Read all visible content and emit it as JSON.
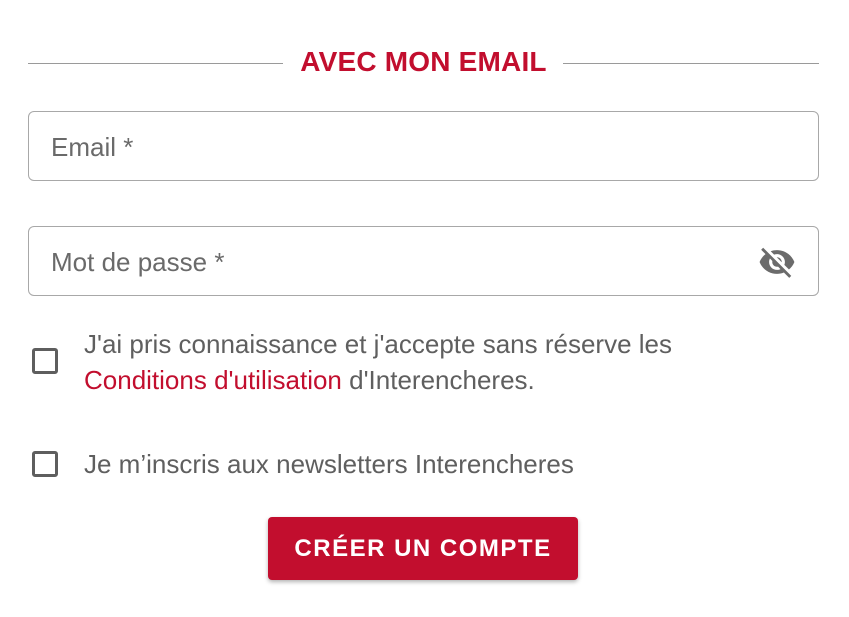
{
  "section": {
    "title": "AVEC MON EMAIL"
  },
  "email": {
    "placeholder": "Email *",
    "value": ""
  },
  "password": {
    "placeholder": "Mot de passe *",
    "value": "",
    "toggle_icon": "eye-off-icon"
  },
  "terms": {
    "text_before": "J'ai pris connaissance et j'accepte sans réserve les ",
    "link": "Conditions d'utilisation",
    "text_after": " d'Interencheres.",
    "checked": false
  },
  "newsletter": {
    "label": "Je m’inscris aux newsletters Interencheres",
    "checked": false
  },
  "submit": {
    "label": "CRÉER UN COMPTE"
  },
  "colors": {
    "accent": "#c20e2e",
    "text": "#5f5f5f",
    "border": "#a8a8a8"
  }
}
